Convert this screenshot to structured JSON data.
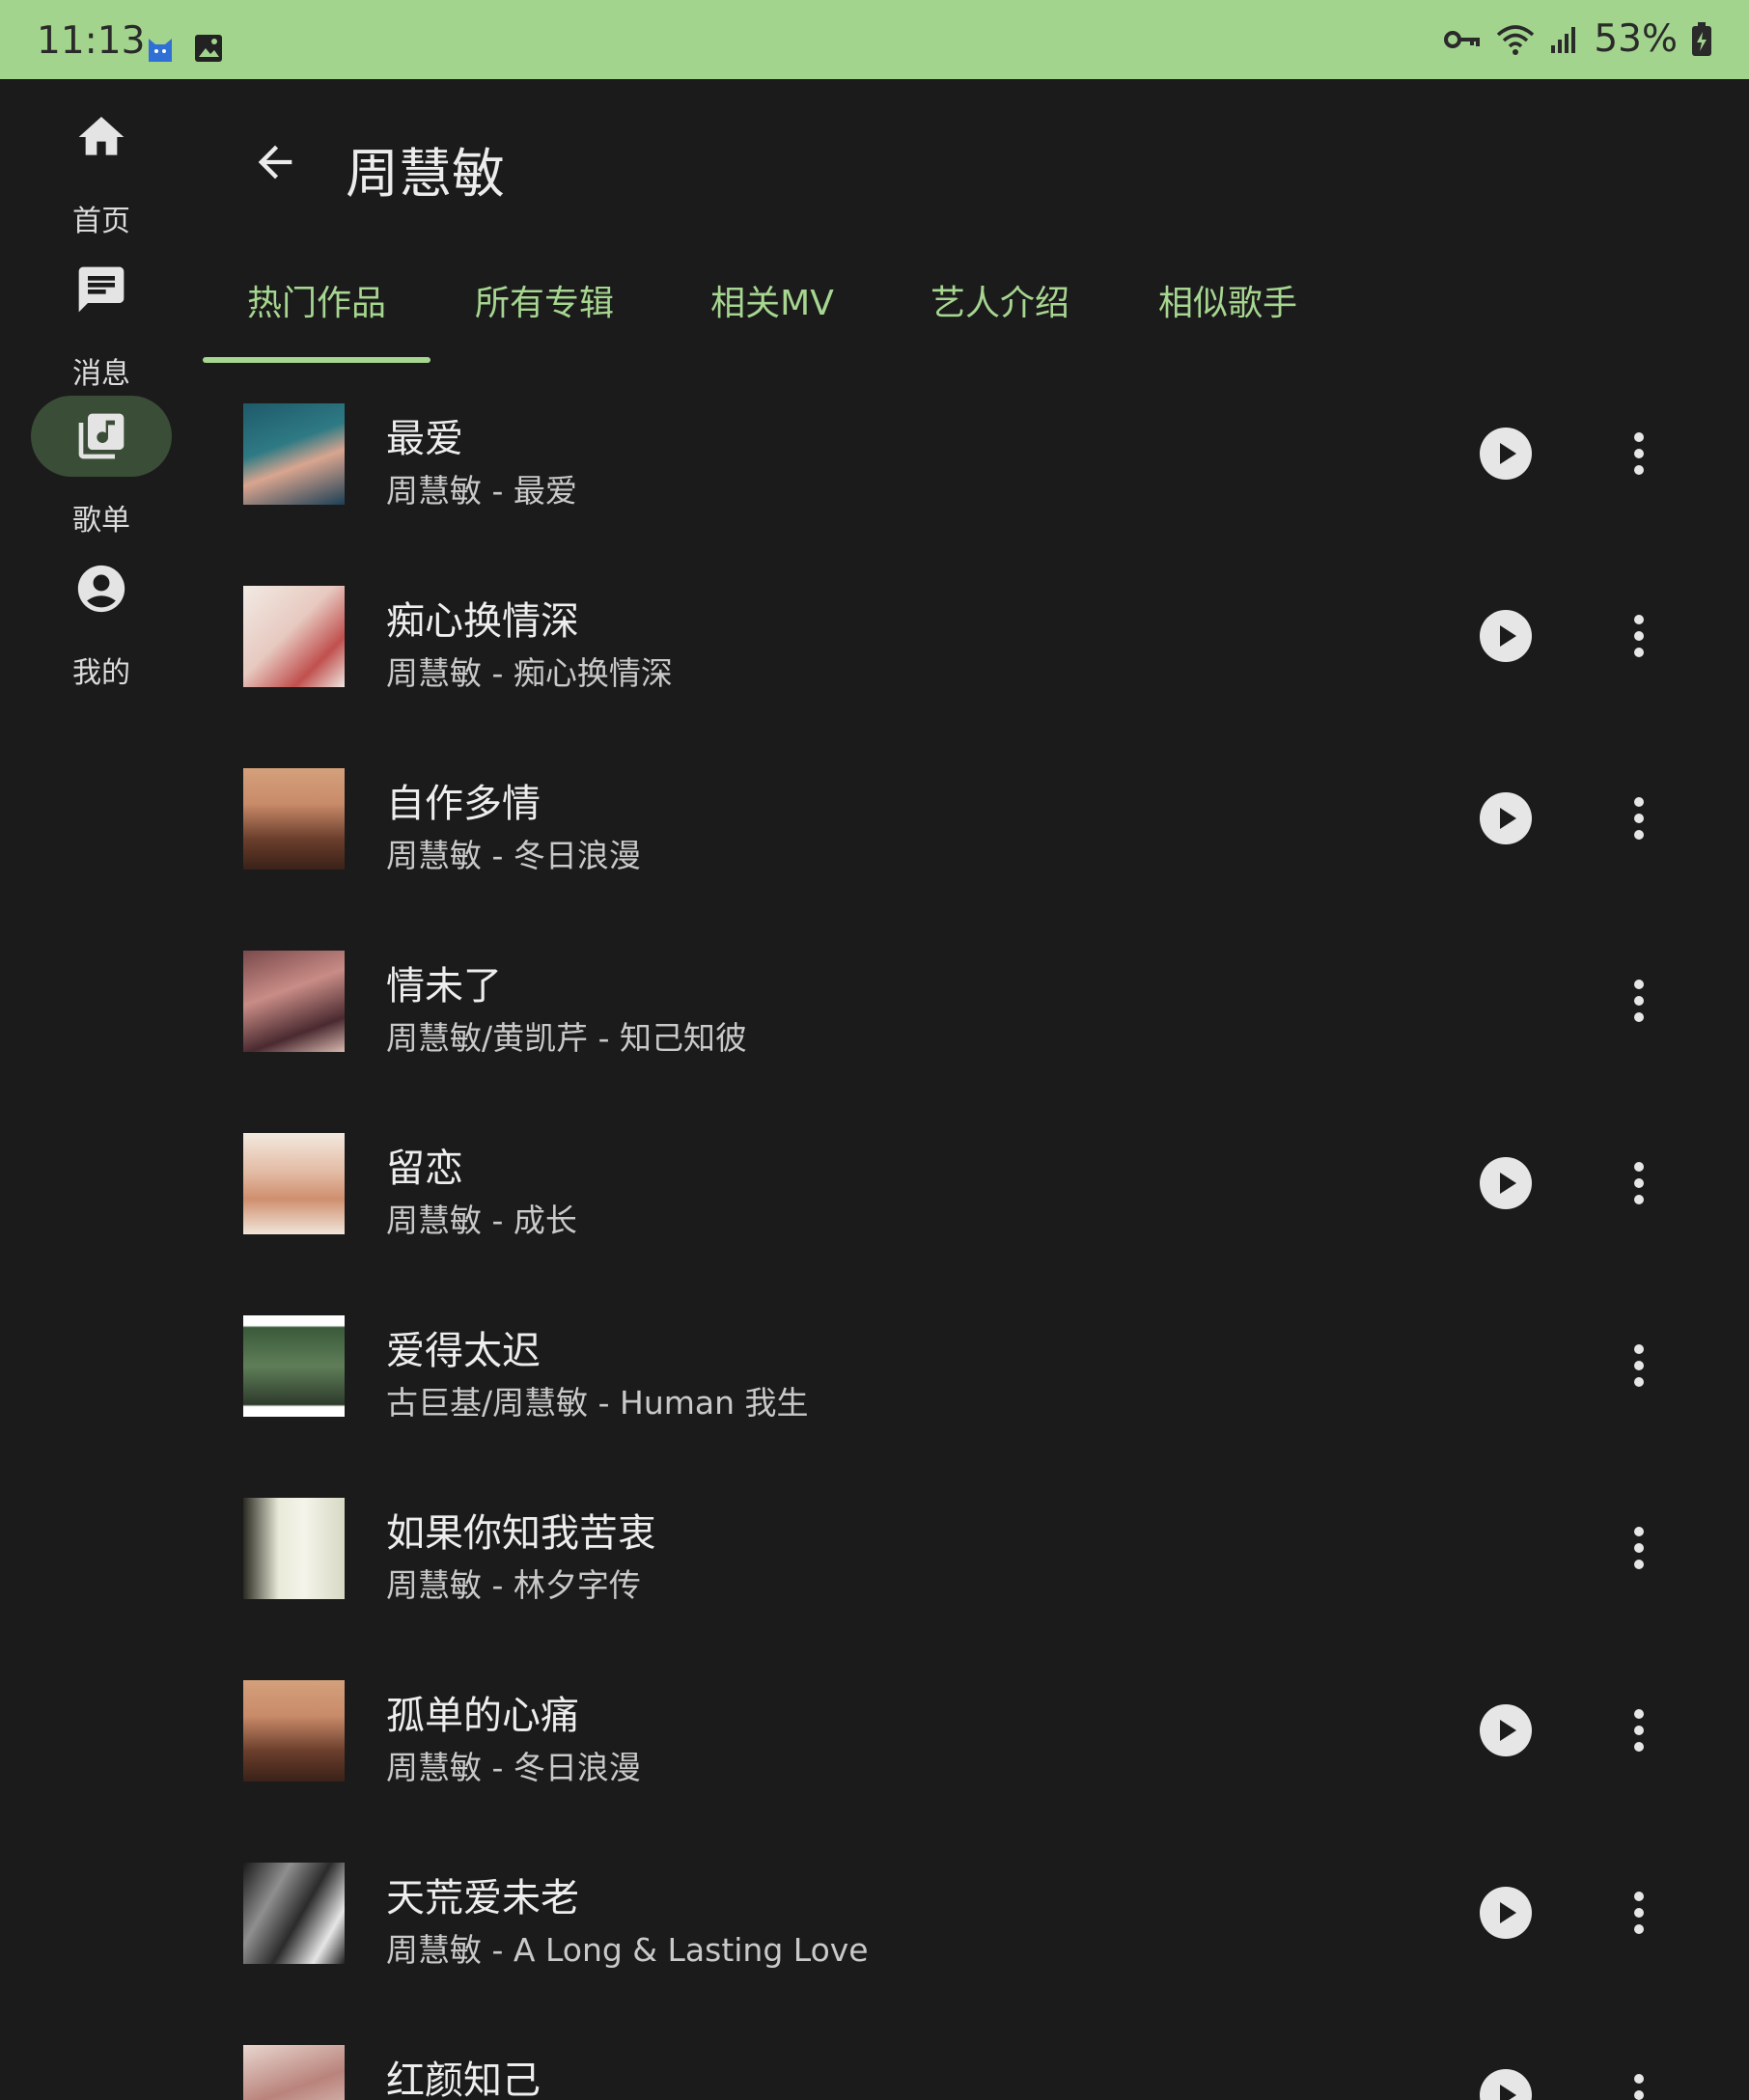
{
  "status_bar": {
    "time": "11:13",
    "battery_percent": "53%",
    "left_icons": [
      "cat-notification-icon",
      "image-notification-icon"
    ],
    "right_icons": [
      "vpn-key-icon",
      "wifi-icon",
      "signal-icon",
      "battery-charging-icon"
    ]
  },
  "nav_rail": {
    "items": [
      {
        "label": "首页",
        "icon": "home-icon",
        "active": false
      },
      {
        "label": "消息",
        "icon": "message-icon",
        "active": false
      },
      {
        "label": "歌单",
        "icon": "music-library-icon",
        "active": true
      },
      {
        "label": "我的",
        "icon": "account-icon",
        "active": false
      }
    ]
  },
  "header": {
    "title": "周慧敏",
    "back_icon": "arrow-back-icon"
  },
  "tabs": [
    {
      "label": "热门作品",
      "selected": true
    },
    {
      "label": "所有专辑",
      "selected": false
    },
    {
      "label": "相关MV",
      "selected": false
    },
    {
      "label": "艺人介绍",
      "selected": false
    },
    {
      "label": "相似歌手",
      "selected": false
    }
  ],
  "songs": [
    {
      "title": "最爱",
      "subtitle": "周慧敏 - 最爱",
      "has_play": true
    },
    {
      "title": "痴心换情深",
      "subtitle": "周慧敏 - 痴心换情深",
      "has_play": true
    },
    {
      "title": "自作多情",
      "subtitle": "周慧敏 - 冬日浪漫",
      "has_play": true
    },
    {
      "title": "情未了",
      "subtitle": "周慧敏/黄凯芹 - 知己知彼",
      "has_play": false
    },
    {
      "title": "留恋",
      "subtitle": "周慧敏 - 成长",
      "has_play": true
    },
    {
      "title": "爱得太迟",
      "subtitle": "古巨基/周慧敏 - Human 我生",
      "has_play": false
    },
    {
      "title": "如果你知我苦衷",
      "subtitle": "周慧敏 - 林夕字传",
      "has_play": false
    },
    {
      "title": "孤单的心痛",
      "subtitle": "周慧敏 - 冬日浪漫",
      "has_play": true
    },
    {
      "title": "天荒爱未老",
      "subtitle": "周慧敏 - A Long & Lasting Love",
      "has_play": true
    },
    {
      "title": "红颜知己",
      "subtitle": "",
      "has_play": true
    }
  ],
  "colors": {
    "background": "#1b1b1c",
    "status_bar": "#a3d48e",
    "accent": "#a6d68f",
    "rail_active": "#3a4d36"
  }
}
